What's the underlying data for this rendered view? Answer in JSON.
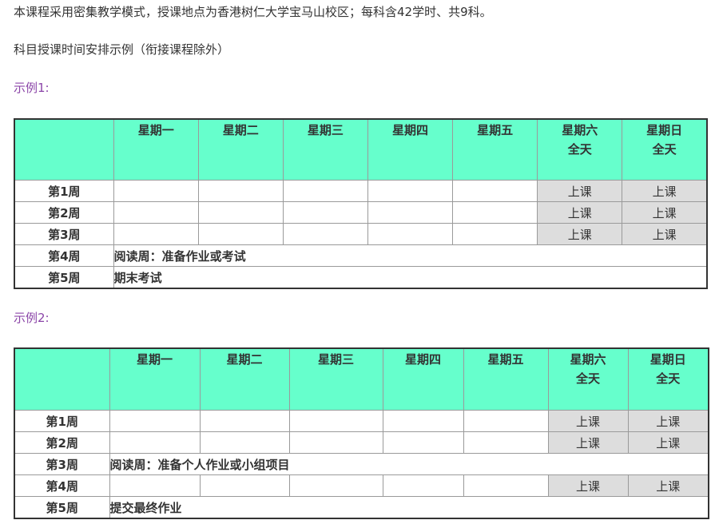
{
  "intro": "本课程采用密集教学模式，授课地点为香港树仁大学宝马山校区；每科含42学时、共9科。",
  "schedule_note": "科目授课时间安排示例（衔接课程除外）",
  "headers": [
    {
      "line1": "星期一",
      "line2": ""
    },
    {
      "line1": "星期二",
      "line2": ""
    },
    {
      "line1": "星期三",
      "line2": ""
    },
    {
      "line1": "星期四",
      "line2": ""
    },
    {
      "line1": "星期五",
      "line2": ""
    },
    {
      "line1": "星期六",
      "line2": "全天"
    },
    {
      "line1": "星期日",
      "line2": "全天"
    }
  ],
  "class_label": "上课",
  "example1": {
    "title": "示例1:",
    "rows": [
      {
        "week": "第1周",
        "note": ""
      },
      {
        "week": "第2周",
        "note": ""
      },
      {
        "week": "第3周",
        "note": ""
      },
      {
        "week": "第4周",
        "note": "阅读周：准备作业或考试"
      },
      {
        "week": "第5周",
        "note": "期末考试"
      }
    ]
  },
  "example2": {
    "title": "示例2:",
    "rows": [
      {
        "week": "第1周",
        "note": ""
      },
      {
        "week": "第2周",
        "note": ""
      },
      {
        "week": "第3周",
        "note": "阅读周：准备个人作业或小组项目"
      },
      {
        "week": "第4周",
        "note": ""
      },
      {
        "week": "第5周",
        "note": "提交最终作业"
      }
    ]
  }
}
